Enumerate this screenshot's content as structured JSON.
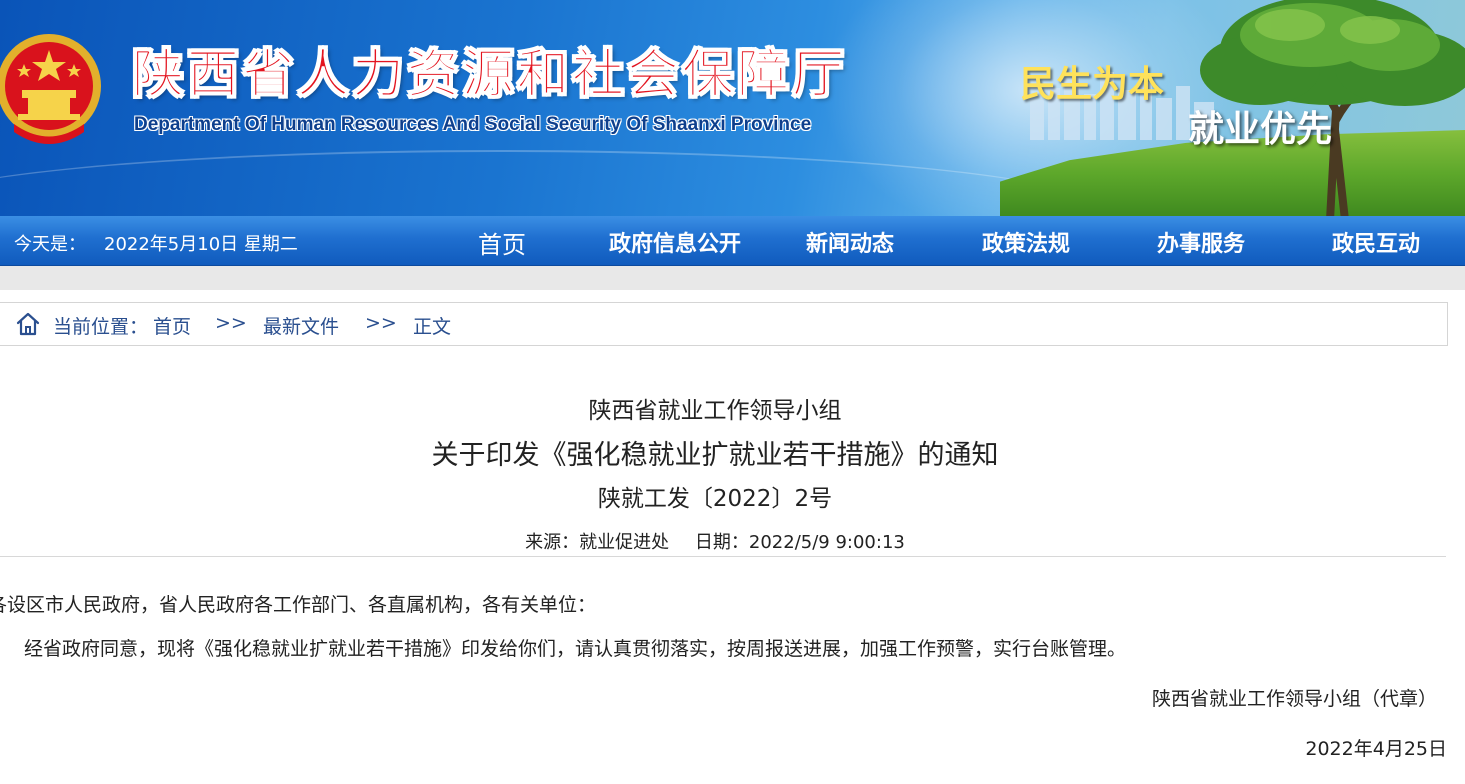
{
  "header": {
    "title": "陕西省人力资源和社会保障厅",
    "subtitle": "Department Of Human Resources And Social Security Of Shaanxi Province",
    "slogan_line1": "民生为本",
    "slogan_line2": "就业优先"
  },
  "nav": {
    "date_prefix": "今天是：",
    "date_value": "2022年5月10日 星期二",
    "items": [
      {
        "label": "首页"
      },
      {
        "label": "政府信息公开"
      },
      {
        "label": "新闻动态"
      },
      {
        "label": "政策法规"
      },
      {
        "label": "办事服务"
      },
      {
        "label": "政民互动"
      }
    ]
  },
  "breadcrumb": {
    "prefix": "当前位置：",
    "items": [
      "首页",
      "最新文件",
      "正文"
    ],
    "separator": ">>"
  },
  "article": {
    "title_line1": "陕西省就业工作领导小组",
    "title_line2": "关于印发《强化稳就业扩就业若干措施》的通知",
    "doc_number": "陕就工发〔2022〕2号",
    "source": "来源：就业促进处",
    "date": "日期：2022/5/9 9:00:13",
    "address": "各设区市人民政府，省人民政府各工作部门、各直属机构，各有关单位：",
    "body": "经省政府同意，现将《强化稳就业扩就业若干措施》印发给你们，请认真贯彻落实，按周报送进展，加强工作预警，实行台账管理。",
    "signature": "陕西省就业工作领导小组（代章）",
    "sign_date": "2022年4月25日"
  },
  "colors": {
    "title_red": "#e3141f",
    "nav_blue": "#1f6fd0",
    "breadcrumb_blue": "#2a4f8f"
  },
  "icons": {
    "emblem": "national-emblem-icon",
    "home": "home-icon"
  }
}
